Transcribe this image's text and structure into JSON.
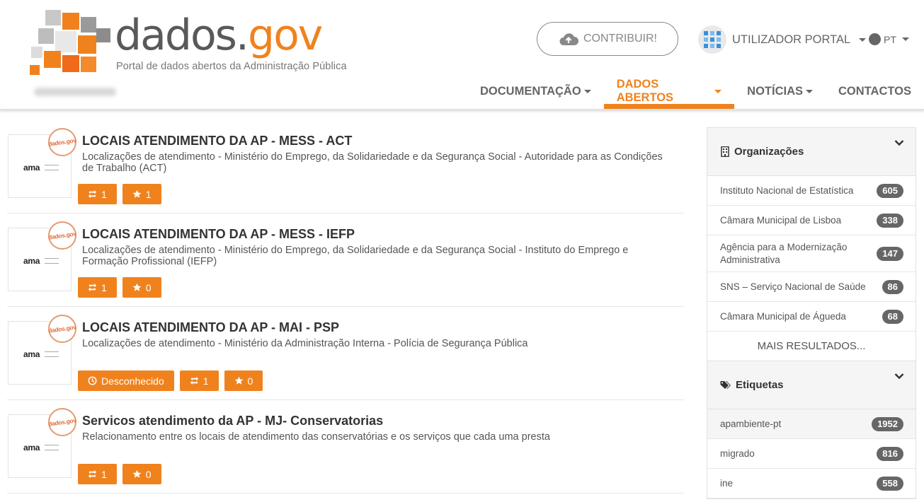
{
  "header": {
    "logo_text_gray": "dados.",
    "logo_text_orange": "gov",
    "logo_subtitle": "Portal de dados abertos da Administração Pública",
    "contribute_label": "CONTRIBUIR!",
    "user_label": "UTILIZADOR PORTAL",
    "lang_label": "PT"
  },
  "nav": {
    "items": [
      {
        "label": "DOCUMENTAÇÃO",
        "dropdown": true,
        "active": false
      },
      {
        "label": "DADOS ABERTOS",
        "dropdown": true,
        "active": true
      },
      {
        "label": "NOTÍCIAS",
        "dropdown": true,
        "active": false
      },
      {
        "label": "CONTACTOS",
        "dropdown": false,
        "active": false
      }
    ]
  },
  "datasets": [
    {
      "logo_text": "ama",
      "stamp_text": "dados.gov",
      "title": "LOCAIS ATENDIMENTO DA AP - MESS - ACT",
      "description": "Localizações de atendimento - Ministério do Emprego, da Solidariedade e da Segurança Social - Autoridade para as Condições de Trabalho (ACT)",
      "reuses": "1",
      "stars": "1"
    },
    {
      "logo_text": "ama",
      "stamp_text": "dados.gov",
      "title": "LOCAIS ATENDIMENTO DA AP - MESS - IEFP",
      "description": "Localizações de atendimento - Ministério do Emprego, da Solidariedade e da Segurança Social - Instituto do Emprego e Formação Profissional (IEFP)",
      "reuses": "1",
      "stars": "0"
    },
    {
      "logo_text": "ama",
      "stamp_text": "dados.gov",
      "title": "LOCAIS ATENDIMENTO DA AP - MAI - PSP",
      "description": "Localizações de atendimento - Ministério da Administração Interna - Polícia de Segurança Pública",
      "frequency": "Desconhecido",
      "reuses": "1",
      "stars": "0"
    },
    {
      "logo_text": "ama",
      "stamp_text": "dados.gov",
      "title": "Servicos atendimento da AP - MJ- Conservatorias",
      "description": "Relacionamento entre os locais de atendimento das conservatórias e os serviços que cada uma presta",
      "reuses": "1",
      "stars": "0"
    }
  ],
  "sidebar": {
    "organizations": {
      "title": "Organizações",
      "items": [
        {
          "name": "Instituto Nacional de Estatística",
          "count": "605"
        },
        {
          "name": "Câmara Municipal de Lisboa",
          "count": "338"
        },
        {
          "name": "Agência para a Modernização Administrativa",
          "count": "147"
        },
        {
          "name": "SNS – Serviço Nacional de Saúde",
          "count": "86"
        },
        {
          "name": "Câmara Municipal de Águeda",
          "count": "68"
        }
      ],
      "more_label": "MAIS RESULTADOS..."
    },
    "tags": {
      "title": "Etiquetas",
      "items": [
        {
          "name": "apambiente-pt",
          "count": "1952"
        },
        {
          "name": "migrado",
          "count": "816"
        },
        {
          "name": "ine",
          "count": "558"
        }
      ]
    }
  },
  "colors": {
    "brand_orange": "#f0821e",
    "text_gray": "#58595b",
    "count_badge": "#666666"
  }
}
